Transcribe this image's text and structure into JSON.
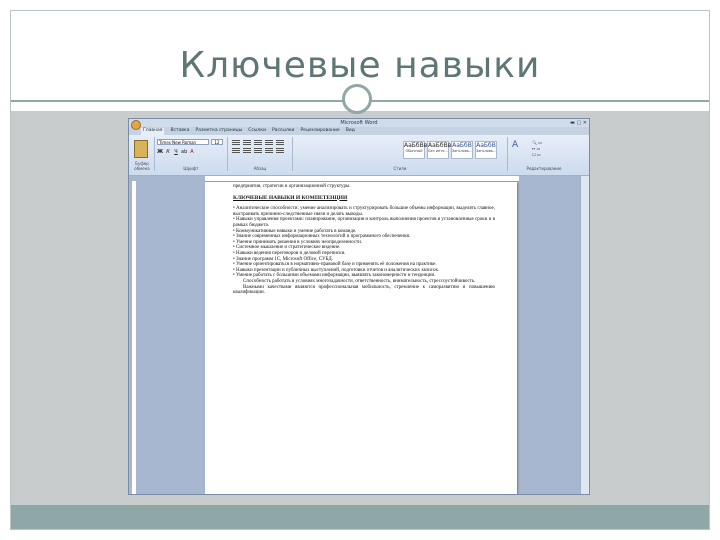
{
  "slide": {
    "title": "Ключевые навыки"
  },
  "word_window": {
    "title_text": "Microsoft Word",
    "tabs": [
      "Главная",
      "Вставка",
      "Разметка страницы",
      "Ссылки",
      "Рассылки",
      "Рецензирование",
      "Вид"
    ],
    "ribbon": {
      "clipboard_label": "Буфер обмена",
      "paste_label": "Вставить",
      "font_name": "Times New Roman",
      "font_size": "12",
      "font_group_label": "Шрифт",
      "paragraph_group_label": "Абзац",
      "styles_group_label": "Стили",
      "editing_group_label": "Редактирование",
      "styles": [
        {
          "sample": "АаБбВвГ",
          "name": "Обычный"
        },
        {
          "sample": "АаБбВвГ",
          "name": "Без инте..."
        },
        {
          "sample": "АаБбВ",
          "name": "Заголово..."
        },
        {
          "sample": "АаБбВ",
          "name": "Заголово..."
        }
      ]
    },
    "document": {
      "first_line": "предприятия, стратегии и организационной структуры.",
      "heading": "КЛЮЧЕВЫЕ НАВЫКИ И КОМПЕТЕНЦИИ",
      "paragraphs": [
        "• Аналитические способности: умение анализировать и структурировать большие объемы информации, выделять главное, выстраивать причинно-следственные связи и делать выводы.",
        "• Навыки управления проектами: планирование, организация и контроль выполнения проектов в установленные сроки и в рамках бюджета.",
        "• Коммуникативные навыки и умение работать в команде.",
        "• Знание современных информационных технологий и программного обеспечения.",
        "• Умение принимать решения в условиях неопределенности.",
        "• Системное мышление и стратегическое видение.",
        "• Навыки ведения переговоров и деловой переписки.",
        "• Знание программ 1С, Microsoft Office, СУБД.",
        "• Умение ориентироваться в нормативно-правовой базе и применять её положения на практике.",
        "• Навыки презентации и публичных выступлений, подготовки отчетов и аналитических записок.",
        "• Умение работать с большими объемами информации, выявлять закономерности и тенденции.",
        "Способность работать в условиях многозадачности, ответственность, внимательность, стрессоустойчивость.",
        "Важными качествами являются профессиональная мобильность, стремление к саморазвитию и повышению квалификации."
      ]
    }
  }
}
